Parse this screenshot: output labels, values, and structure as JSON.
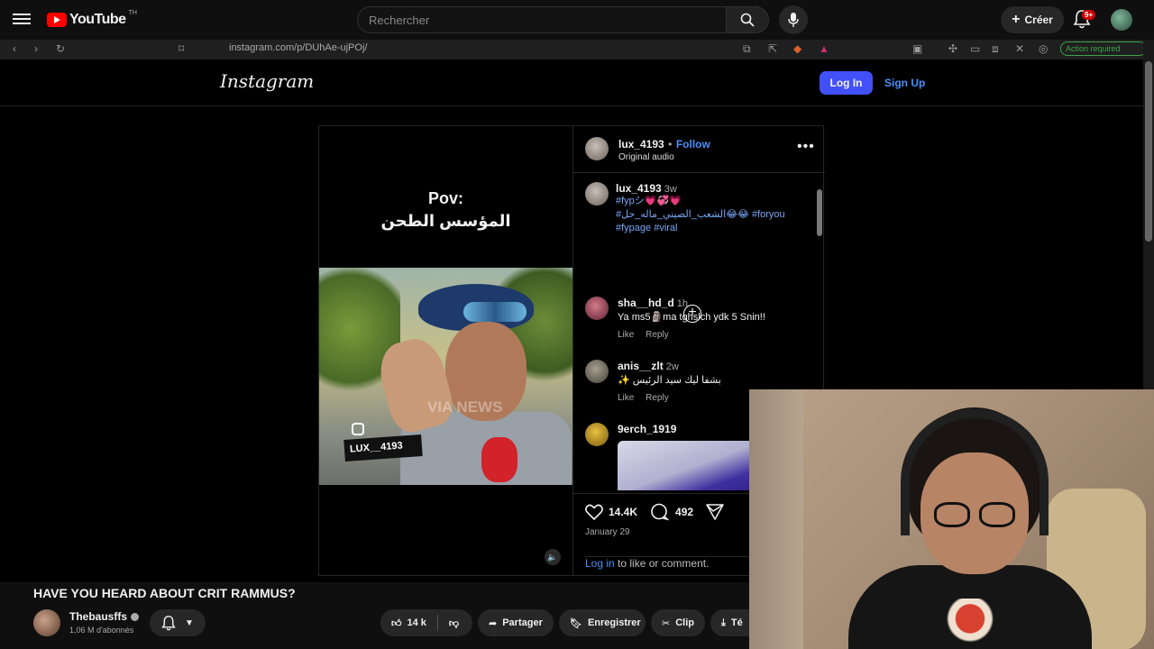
{
  "youtube": {
    "logo_text": "YouTube",
    "logo_sup": "TH",
    "search_placeholder": "Rechercher",
    "create_label": "Créer",
    "notif_badge": "9+",
    "video_title": "HAVE YOU HEARD ABOUT CRIT RAMMUS?",
    "channel_name": "Thebausffs",
    "channel_subs": "1,06 M d'abonnés",
    "like_count": "14 k",
    "share_label": "Partager",
    "save_label": "Enregistrer",
    "clip_label": "Clip",
    "download_label": "Té"
  },
  "browser": {
    "url": "instagram.com/p/DUhAe-ujPOj/",
    "action_required": "Action required"
  },
  "instagram": {
    "logo": "Instagram",
    "login_label": "Log In",
    "signup_label": "Sign Up",
    "post": {
      "pov_line1": "Pov:",
      "pov_line2": "المؤسس الطحن",
      "video_tag": "LUX__4193",
      "video_watermark": "VIA NEWS",
      "author": "lux_4193",
      "dot": "•",
      "follow_label": "Follow",
      "audio": "Original audio",
      "caption_author": "lux_4193",
      "caption_time": "3w",
      "caption_line1": "#fypシ💗💞💗",
      "caption_line2": "#الشعب_الصيني_ماله_حل😂😂 #foryou",
      "caption_line3": "#fypage #viral",
      "likes": "14.4K",
      "comments_count": "492",
      "date": "January 29",
      "login_link": "Log in",
      "login_rest": "to like or comment."
    },
    "comments": [
      {
        "user": "sha__hd_d",
        "time": "1h",
        "text": "Ya ms5🗿ma tghslch ydk 5 Snin!!",
        "like": "Like",
        "reply": "Reply"
      },
      {
        "user": "anis__zlt",
        "time": "2w",
        "text": "✨ بشفا ليك سيد الرئيس",
        "like": "Like",
        "reply": "Reply"
      },
      {
        "user": "9erch_1919",
        "time": "",
        "text": "",
        "like": "",
        "reply": ""
      }
    ]
  }
}
